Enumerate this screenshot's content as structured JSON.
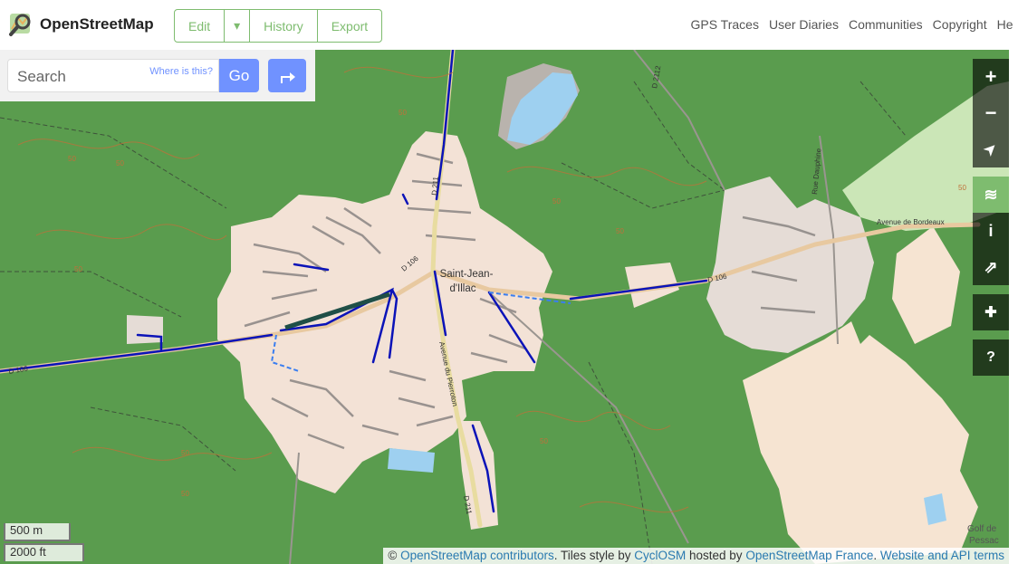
{
  "brand": {
    "name": "OpenStreetMap"
  },
  "toolbar": {
    "edit": "Edit",
    "dropdown": "▾",
    "history": "History",
    "export": "Export"
  },
  "nav": {
    "gps_traces": "GPS Traces",
    "user_diaries": "User Diaries",
    "communities": "Communities",
    "copyright": "Copyright",
    "help": "He"
  },
  "search": {
    "placeholder": "Search",
    "where_is_this": "Where is this?",
    "go": "Go"
  },
  "controls": [
    {
      "name": "zoom-in-button",
      "glyph": "+"
    },
    {
      "name": "zoom-out-button",
      "glyph": "−"
    },
    {
      "name": "locate-button",
      "glyph": "➤"
    },
    {
      "name": "layers-button",
      "glyph": "≋"
    },
    {
      "name": "map-info-button",
      "glyph": "i"
    },
    {
      "name": "share-button",
      "glyph": "⇗"
    },
    {
      "name": "add-note-button",
      "glyph": "✚"
    },
    {
      "name": "query-features-button",
      "glyph": "?"
    }
  ],
  "map": {
    "place_label": [
      "Saint-Jean-",
      "d'Illac"
    ],
    "roads": [
      "D 106",
      "D 106",
      "D 106",
      "Avenue de Bordeaux",
      "Rue Dauphine",
      "Avenue du Pierroton",
      "D 211",
      "D 211",
      "D 2112"
    ],
    "golf_label": [
      "Golf de",
      "Pessac"
    ],
    "contour_value": "50",
    "colors": {
      "forest": "#5a9c4e",
      "urban": "#f3e2d6",
      "water": "#9ed0f0",
      "cycleway": "#0b13b8",
      "sand": "#f6e4d2"
    }
  },
  "scale": {
    "metric": "500 m",
    "imperial": "2000 ft"
  },
  "attribution": {
    "prefix": "©",
    "contributors": "OpenStreetMap contributors",
    "tiles_text": ". Tiles style by",
    "cyclosm": "CyclOSM",
    "hosted_text": "hosted by",
    "osm_france": "OpenStreetMap France",
    "terms": "Website and API terms"
  }
}
